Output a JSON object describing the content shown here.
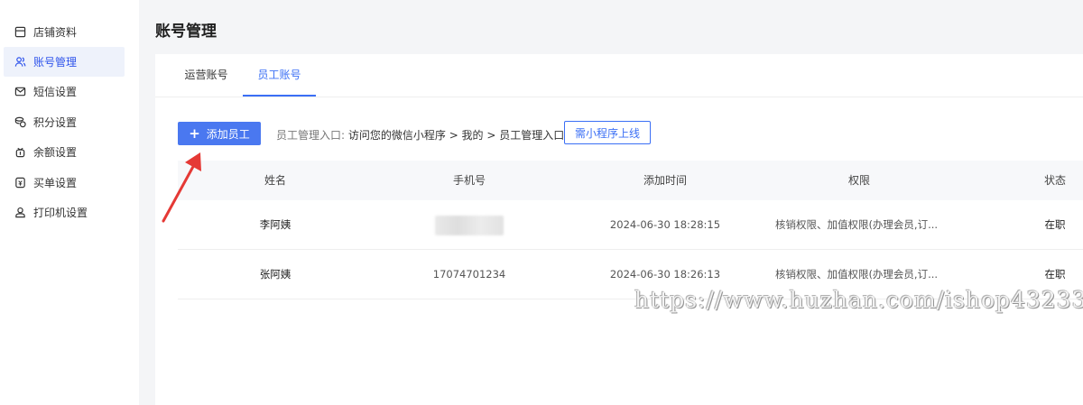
{
  "sidebar": {
    "items": [
      {
        "label": "店铺资料",
        "icon": "shop-icon",
        "active": false
      },
      {
        "label": "账号管理",
        "icon": "user-group-icon",
        "active": true
      },
      {
        "label": "短信设置",
        "icon": "mail-icon",
        "active": false
      },
      {
        "label": "积分设置",
        "icon": "coins-icon",
        "active": false
      },
      {
        "label": "余额设置",
        "icon": "wallet-icon",
        "active": false
      },
      {
        "label": "买单设置",
        "icon": "bill-icon",
        "active": false
      },
      {
        "label": "打印机设置",
        "icon": "person-icon",
        "active": false
      }
    ]
  },
  "header": {
    "title": "账号管理"
  },
  "tabs": [
    {
      "label": "运营账号",
      "active": false
    },
    {
      "label": "员工账号",
      "active": true
    }
  ],
  "toolbar": {
    "add_label": "添加员工",
    "entry_label": "员工管理入口:",
    "entry_path": "访问您的微信小程序 > 我的 > 员工管理入口",
    "mini_btn_label": "需小程序上线"
  },
  "table": {
    "columns": [
      "姓名",
      "手机号",
      "添加时间",
      "权限",
      "状态"
    ],
    "rows": [
      {
        "name": "李阿姨",
        "phone": "",
        "phone_blurred": true,
        "time": "2024-06-30 18:28:15",
        "perm": "核销权限、加值权限(办理会员,订...",
        "status": "在职"
      },
      {
        "name": "张阿姨",
        "phone": "17074701234",
        "phone_blurred": false,
        "time": "2024-06-30 18:26:13",
        "perm": "核销权限、加值权限(办理会员,订...",
        "status": "在职"
      }
    ]
  },
  "watermark": "https://www.huzhan.com/ishop43233",
  "colors": {
    "accent": "#3b6ff5",
    "button": "#4a78f0",
    "annotation_arrow": "#e53935",
    "sidebar_active_bg": "#eef2fb"
  }
}
